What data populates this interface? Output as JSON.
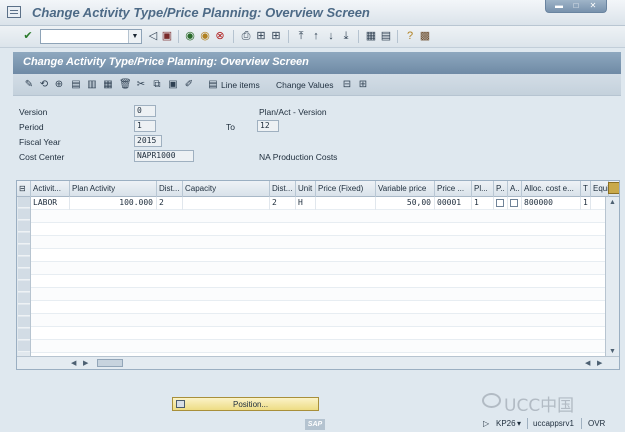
{
  "window": {
    "title": "Change Activity Type/Price Planning: Overview Screen"
  },
  "std_toolbar": {
    "command_field_value": "",
    "icons": [
      "enter-icon",
      "back-icon",
      "save-icon",
      "exit-icon",
      "cancel-icon",
      "print-icon",
      "find-icon",
      "find-next-icon",
      "first-page-icon",
      "prev-page-icon",
      "next-page-icon",
      "last-page-icon",
      "new-session-icon",
      "shortcut-icon",
      "help-icon",
      "layout-icon"
    ]
  },
  "screen": {
    "title": "Change Activity Type/Price Planning: Overview Screen"
  },
  "app_toolbar": {
    "line_items_label": "Line items",
    "change_values_label": "Change Values"
  },
  "header": {
    "version_label": "Version",
    "version_value": "0",
    "plan_act_label": "Plan/Act - Version",
    "period_label": "Period",
    "period_from": "1",
    "to_label": "To",
    "period_to": "12",
    "fiscal_year_label": "Fiscal Year",
    "fiscal_year_value": "2015",
    "cost_center_label": "Cost Center",
    "cost_center_value": "NAPR1000",
    "cost_center_desc": "NA Production Costs"
  },
  "table": {
    "columns": [
      "Activit...",
      "Plan Activity",
      "Dist...",
      "Capacity",
      "Dist...",
      "Unit",
      "Price (Fixed)",
      "Variable price",
      "Price ...",
      "Pl...",
      "P..",
      "A..",
      "Alloc. cost e...",
      "T",
      "Equi..."
    ],
    "rows": [
      {
        "activity": "LABOR",
        "plan_activity": "100.000",
        "dist1": "2",
        "capacity": "",
        "dist2": "2",
        "unit": "H",
        "price_fixed": "",
        "variable_price": "50,00",
        "price_unit": "00001",
        "plan_ind": "1",
        "p_checked": false,
        "a_checked": false,
        "alloc_cost_elem": "800000",
        "t": "1",
        "equi": ""
      }
    ]
  },
  "position_button": {
    "label": "Position..."
  },
  "status_bar": {
    "transaction": "KP26",
    "server": "uccappsrv1",
    "mode": "OVR"
  },
  "watermark": {
    "text": "UCC中国"
  }
}
